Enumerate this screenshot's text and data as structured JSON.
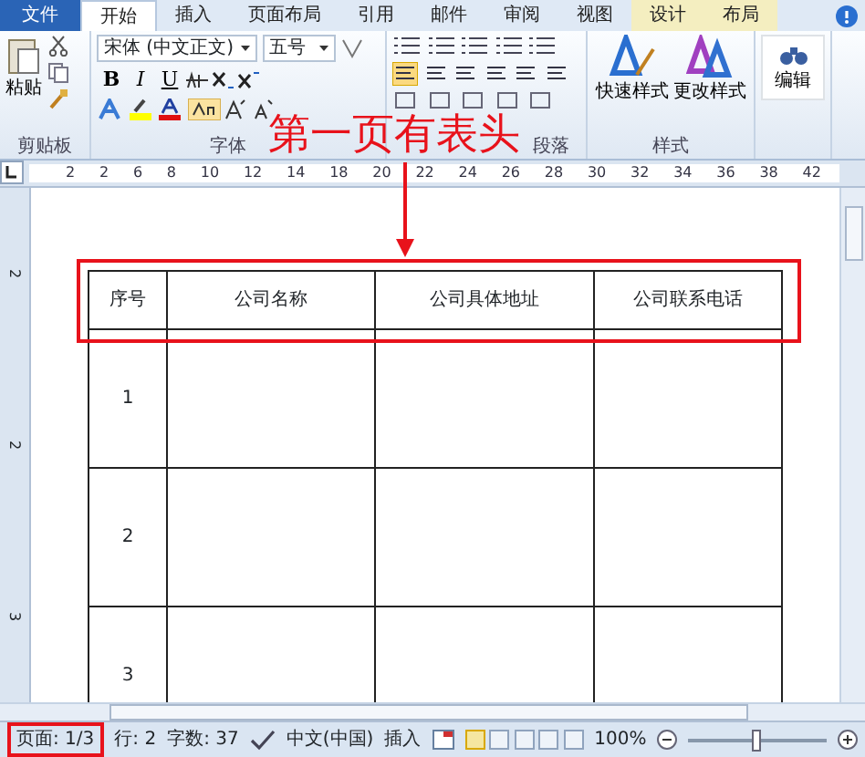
{
  "tabs": [
    {
      "label": "文件",
      "kind": "file",
      "selected": false
    },
    {
      "label": "开始",
      "kind": "main",
      "selected": true
    },
    {
      "label": "插入",
      "kind": "main",
      "selected": false
    },
    {
      "label": "页面布局",
      "kind": "main",
      "selected": false
    },
    {
      "label": "引用",
      "kind": "main",
      "selected": false
    },
    {
      "label": "邮件",
      "kind": "main",
      "selected": false
    },
    {
      "label": "审阅",
      "kind": "main",
      "selected": false
    },
    {
      "label": "视图",
      "kind": "main",
      "selected": false
    },
    {
      "label": "设计",
      "kind": "context",
      "selected": false
    },
    {
      "label": "布局",
      "kind": "context",
      "selected": false
    }
  ],
  "ribbon": {
    "clipboard": {
      "paste": "粘贴",
      "label": "剪贴板"
    },
    "font": {
      "font_name": "宋体 (中文正文)",
      "font_size": "五号",
      "format_buttons": [
        "B",
        "I",
        "U"
      ],
      "label": "字体"
    },
    "paragraph": {
      "label": "段落"
    },
    "styles": {
      "buttons": [
        "快速样式",
        "更改样式"
      ],
      "label": "样式"
    },
    "editing": {
      "button": "编辑"
    }
  },
  "annotation": {
    "text": "第一页有表头"
  },
  "ruler": {
    "labels": [
      "2",
      "2",
      "6",
      "8",
      "10",
      "12",
      "14",
      "18",
      "20",
      "22",
      "24",
      "26",
      "28",
      "30",
      "32",
      "34",
      "36",
      "38",
      "42"
    ]
  },
  "vertical_ruler": {
    "labels": [
      "2",
      "2",
      "3"
    ]
  },
  "table": {
    "columns": [
      "序号",
      "公司名称",
      "公司具体地址",
      "公司联系电话"
    ],
    "rows": [
      {
        "number": "1"
      },
      {
        "number": "2"
      },
      {
        "number": "3"
      }
    ]
  },
  "status_bar": {
    "page": "页面: 1/3",
    "line": "行: 2",
    "words": "字数: 37",
    "language": "中文(中国)",
    "mode": "插入",
    "views": [
      {
        "selected": true
      },
      {
        "selected": false
      },
      {
        "selected": false
      },
      {
        "selected": false
      },
      {
        "selected": false
      }
    ],
    "zoom": "100%",
    "zoom_slider": {
      "level": 0.5
    }
  }
}
